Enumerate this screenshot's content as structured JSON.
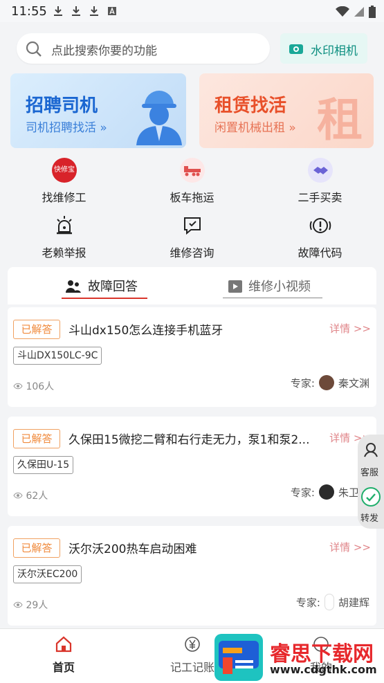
{
  "status": {
    "time": "11:55"
  },
  "search": {
    "placeholder": "点此搜索你要的功能"
  },
  "camera": {
    "label": "水印相机"
  },
  "banners": [
    {
      "title": "招聘司机",
      "subtitle": "司机招聘找活 »"
    },
    {
      "title": "租赁找活",
      "subtitle": "闲置机械出租 »",
      "mark": "租"
    }
  ],
  "grid": [
    {
      "label": "找维修工",
      "icon_text": "快修宝"
    },
    {
      "label": "板车拖运"
    },
    {
      "label": "二手买卖"
    },
    {
      "label": "老赖举报"
    },
    {
      "label": "维修咨询"
    },
    {
      "label": "故障代码"
    }
  ],
  "tabs": [
    {
      "label": "故障回答"
    },
    {
      "label": "维修小视频"
    }
  ],
  "cards": [
    {
      "status": "已解答",
      "question": "斗山dx150怎么连接手机蓝牙",
      "detail": "详情 >>",
      "model": "斗山DX150LC-9C",
      "views": "106人",
      "expert_label": "专家:",
      "expert": "秦文渊"
    },
    {
      "status": "已解答",
      "question": "久保田15微挖二臂和右行走无力，泵1和泵2...",
      "detail": "详情 >>",
      "model": "久保田U-15",
      "views": "62人",
      "expert_label": "专家:",
      "expert": "朱卫东"
    },
    {
      "status": "已解答",
      "question": "沃尔沃200热车启动困难",
      "detail": "详情 >>",
      "model": "沃尔沃EC200",
      "views": "29人",
      "expert_label": "专家:",
      "expert": "胡建辉"
    }
  ],
  "float": {
    "service": "客服",
    "share": "转发"
  },
  "nav": [
    {
      "label": "首页"
    },
    {
      "label": "记工记账"
    },
    {
      "label": "我的"
    }
  ],
  "watermark": {
    "title": "睿思下载网",
    "url": "www.cdgthk.com"
  },
  "colors": {
    "accent": "#d9352b",
    "teal": "#0d8f80",
    "orange": "#f08a3c"
  }
}
